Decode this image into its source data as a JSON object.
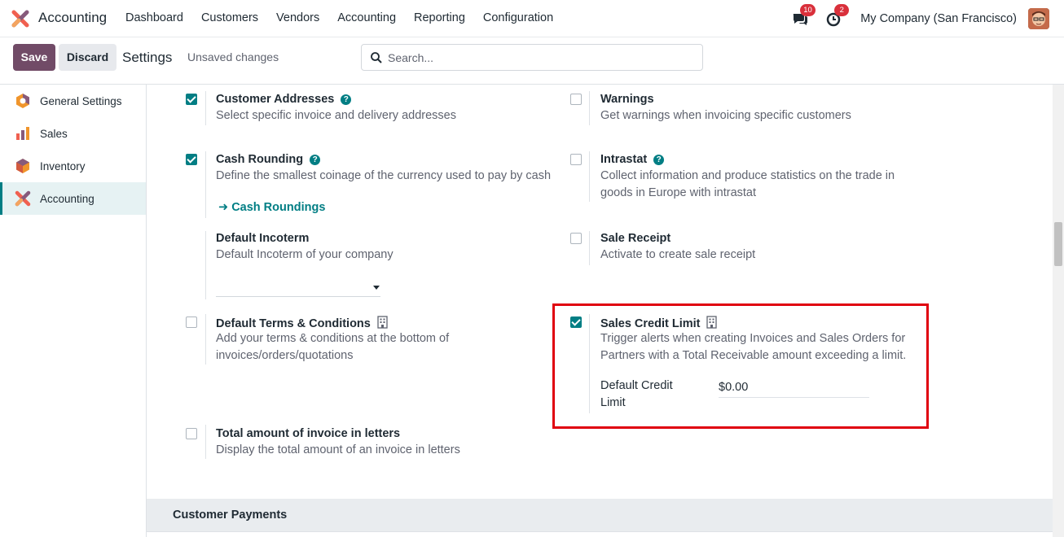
{
  "navbar": {
    "app_name": "Accounting",
    "menu": [
      "Dashboard",
      "Customers",
      "Vendors",
      "Accounting",
      "Reporting",
      "Configuration"
    ],
    "messages_count": "10",
    "activities_count": "2",
    "company": "My Company (San Francisco)"
  },
  "control_panel": {
    "save_label": "Save",
    "discard_label": "Discard",
    "title": "Settings",
    "status": "Unsaved changes",
    "search_placeholder": "Search..."
  },
  "sidebar": {
    "items": [
      {
        "label": "General Settings",
        "icon": "general-settings-icon",
        "active": false
      },
      {
        "label": "Sales",
        "icon": "sales-icon",
        "active": false
      },
      {
        "label": "Inventory",
        "icon": "inventory-icon",
        "active": false
      },
      {
        "label": "Accounting",
        "icon": "accounting-icon",
        "active": true
      }
    ]
  },
  "settings": {
    "customer_addresses": {
      "title": "Customer Addresses",
      "desc": "Select specific invoice and delivery addresses",
      "checked": true
    },
    "warnings": {
      "title": "Warnings",
      "desc": "Get warnings when invoicing specific customers",
      "checked": false
    },
    "cash_rounding": {
      "title": "Cash Rounding",
      "desc": "Define the smallest coinage of the currency used to pay by cash",
      "checked": true,
      "link": "Cash Roundings"
    },
    "intrastat": {
      "title": "Intrastat",
      "desc": "Collect information and produce statistics on the trade in goods in Europe with intrastat",
      "checked": false
    },
    "default_incoterm": {
      "title": "Default Incoterm",
      "desc": "Default Incoterm of your company",
      "value": ""
    },
    "sale_receipt": {
      "title": "Sale Receipt",
      "desc": "Activate to create sale receipt",
      "checked": false
    },
    "default_terms": {
      "title": "Default Terms & Conditions",
      "desc": "Add your terms & conditions at the bottom of invoices/orders/quotations",
      "checked": false
    },
    "sales_credit_limit": {
      "title": "Sales Credit Limit",
      "desc": "Trigger alerts when creating Invoices and Sales Orders for Partners with a Total Receivable amount exceeding a limit.",
      "checked": true,
      "field_label": "Default Credit Limit",
      "field_value": "$0.00"
    },
    "invoice_letters": {
      "title": "Total amount of invoice in letters",
      "desc": "Display the total amount of an invoice in letters",
      "checked": false
    }
  },
  "section": {
    "title": "Customer Payments"
  },
  "colors": {
    "primary": "#714b67",
    "accent": "#017e84",
    "highlight": "#e0000f"
  }
}
